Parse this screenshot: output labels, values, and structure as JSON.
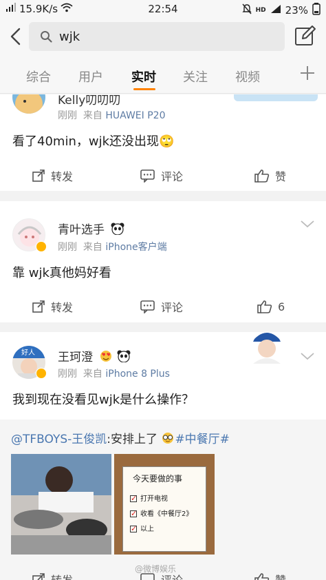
{
  "status": {
    "speed": "15.9K/s",
    "time": "22:54",
    "battery": "23%",
    "hd": "HD"
  },
  "search": {
    "query": "wjk"
  },
  "tabs": [
    {
      "label": "综合"
    },
    {
      "label": "用户"
    },
    {
      "label": "实时"
    },
    {
      "label": "关注"
    },
    {
      "label": "视频"
    }
  ],
  "posts": [
    {
      "user": "Kelly叨叨叨",
      "time": "刚刚",
      "from": "来自",
      "source": "HUAWEI P20",
      "text": "看了40min，wjk还没出现",
      "emoji": "🙄",
      "repost": "转发",
      "comment": "评论",
      "like": "赞"
    },
    {
      "user": "青叶选手",
      "time": "刚刚",
      "from": "来自",
      "source": "iPhone客户端",
      "text": "靠 wjk真他妈好看",
      "repost": "转发",
      "comment": "评论",
      "like": "6"
    },
    {
      "user": "王珂澄",
      "time": "刚刚",
      "from": "来自",
      "source": "iPhone 8 Plus",
      "text": "我到现在没看见wjk是什么操作？",
      "avatar_text": "好人",
      "repost": "转发",
      "comment": "评论",
      "like": "赞"
    }
  ],
  "retweet": {
    "mention": "@TFBOYS-王俊凯",
    "text": ":安排上了",
    "hashtag": "#中餐厅#",
    "note_title": "今天要做的事",
    "note_items": [
      "打开电视",
      "收看《中餐厅2》",
      "以上"
    ],
    "watermark": "@微博娱乐"
  }
}
